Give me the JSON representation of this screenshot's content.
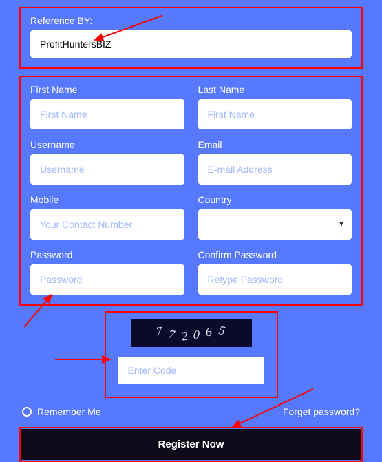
{
  "reference": {
    "label": "Reference BY:",
    "value": "ProfitHuntersBIZ"
  },
  "fields": {
    "first_name": {
      "label": "First Name",
      "placeholder": "First Name"
    },
    "last_name": {
      "label": "Last Name",
      "placeholder": "First Name"
    },
    "username": {
      "label": "Username",
      "placeholder": "Username"
    },
    "email": {
      "label": "Email",
      "placeholder": "E-mail Address"
    },
    "mobile": {
      "label": "Mobile",
      "placeholder": "Your Contact Number"
    },
    "country": {
      "label": "Country"
    },
    "password": {
      "label": "Password",
      "placeholder": "Password"
    },
    "confirm_password": {
      "label": "Confirm Password",
      "placeholder": "Retype Password"
    }
  },
  "captcha": {
    "code": "772065",
    "placeholder": "Enter Code"
  },
  "remember_label": "Remember Me",
  "forget_label": "Forget password?",
  "register_label": "Register Now"
}
